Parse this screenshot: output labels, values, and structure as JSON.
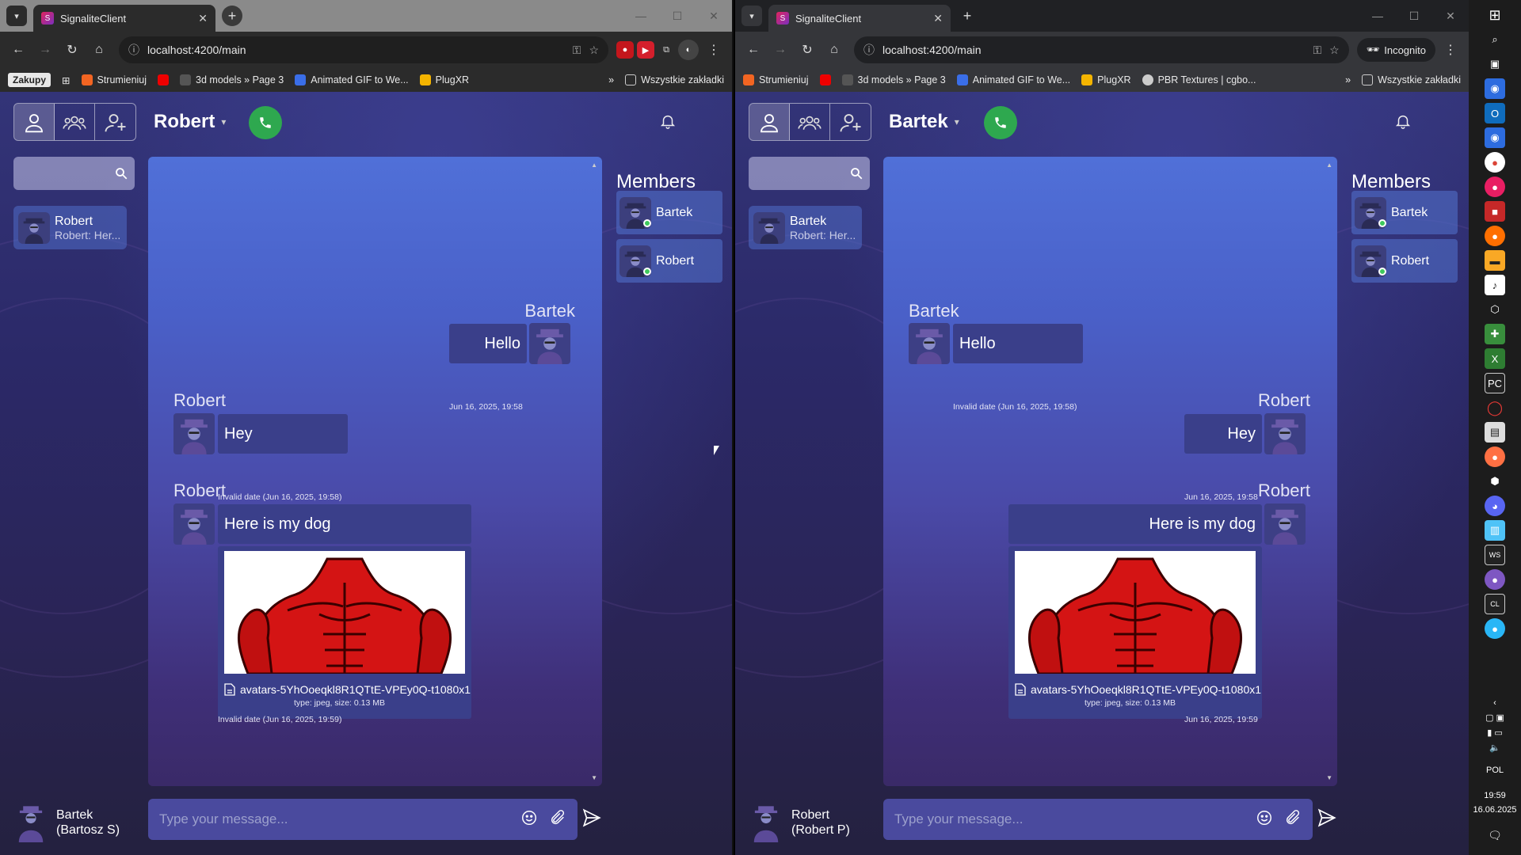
{
  "browser_left": {
    "tab_title": "SignaliteClient",
    "url": "localhost:4200/main",
    "bookmarks": [
      "Zakupy",
      "Strumieniuj",
      "3d models » Page 3",
      "Animated GIF to We...",
      "PlugXR"
    ],
    "all_bookmarks": "Wszystkie zakładki"
  },
  "browser_right": {
    "tab_title": "SignaliteClient",
    "url": "localhost:4200/main",
    "incognito": "Incognito",
    "bookmarks": [
      "Strumieniuj",
      "3d models » Page 3",
      "Animated GIF to We...",
      "PlugXR",
      "PBR Textures | cgbo..."
    ],
    "all_bookmarks": "Wszystkie zakładki"
  },
  "left": {
    "channel_name": "Robert",
    "conversation": {
      "name": "Robert",
      "preview": "Robert: Her..."
    },
    "members_title": "Members",
    "members": [
      "Bartek",
      "Robert"
    ],
    "messages": [
      {
        "sender": "Bartek",
        "text": "Hello",
        "time": "Jun 16, 2025, 19:58"
      },
      {
        "sender": "Robert",
        "text": "Hey",
        "time": "Invalid date (Jun 16, 2025, 19:58)"
      },
      {
        "sender": "Robert",
        "text": "Here is my dog",
        "file_name": "avatars-5YhOoeqkl8R1QTtE-VPEy0Q-t1080x1",
        "file_meta": "type: jpeg, size: 0.13 MB",
        "time": "Invalid date (Jun 16, 2025, 19:59)"
      }
    ],
    "current_user": {
      "name": "Bartek",
      "sub": "(Bartosz S)"
    },
    "composer_placeholder": "Type your message..."
  },
  "right": {
    "channel_name": "Bartek",
    "conversation": {
      "name": "Bartek",
      "preview": "Robert: Her..."
    },
    "members_title": "Members",
    "members": [
      "Bartek",
      "Robert"
    ],
    "messages": [
      {
        "sender": "Bartek",
        "text": "Hello",
        "time": "Invalid date (Jun 16, 2025, 19:58)"
      },
      {
        "sender": "Robert",
        "text": "Hey",
        "time": "Jun 16, 2025, 19:58"
      },
      {
        "sender": "Robert",
        "text": "Here is my dog",
        "file_name": "avatars-5YhOoeqkl8R1QTtE-VPEy0Q-t1080x1",
        "file_meta": "type: jpeg, size: 0.13 MB",
        "time": "Jun 16, 2025, 19:59"
      }
    ],
    "current_user": {
      "name": "Robert",
      "sub": "(Robert P)"
    },
    "composer_placeholder": "Type your message..."
  },
  "taskbar": {
    "lang": "POL",
    "time": "19:59",
    "date": "16.06.2025"
  },
  "colors": {
    "call_green": "#2ea84f",
    "online_green": "#3ec95c",
    "bubble": "#3a3f8a"
  }
}
